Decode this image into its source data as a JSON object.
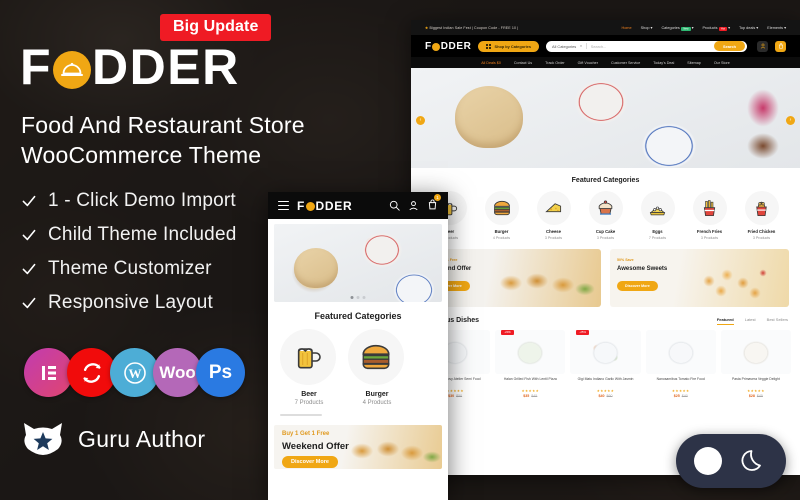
{
  "promo": {
    "badge": "Big Update",
    "brand": "F",
    "brand_rest": "DDER",
    "headline_line1": "Food And Restaurant Store",
    "headline_line2": "WooCommerce Theme",
    "features": [
      "1 - Click Demo Import",
      "Child Theme Included",
      "Theme Customizer",
      "Responsive Layout"
    ],
    "tech_badges": [
      {
        "name": "elementor-icon",
        "label": "E"
      },
      {
        "name": "revolution-slider-icon",
        "label": "↺"
      },
      {
        "name": "wordpress-icon",
        "label": "W"
      },
      {
        "name": "woocommerce-icon",
        "label": "Woo"
      },
      {
        "name": "photoshop-icon",
        "label": "Ps"
      }
    ],
    "author_label": "Guru Author",
    "accent_color": "#f0a714",
    "badge_color": "#ef1b24"
  },
  "desktop": {
    "topbar": {
      "promo_text": "Biggest Indian Sale Fest | Coupon Code - FREE 10 |",
      "nav": [
        {
          "label": "Home",
          "active": true,
          "pill": ""
        },
        {
          "label": "Shop ▾",
          "active": false,
          "pill": ""
        },
        {
          "label": "Categories",
          "active": false,
          "pill": "New"
        },
        {
          "label": "Products",
          "active": false,
          "pill": "Hot"
        },
        {
          "label": "Top deals ▾",
          "active": false,
          "pill": ""
        },
        {
          "label": "Elements ▾",
          "active": false,
          "pill": ""
        }
      ]
    },
    "header": {
      "logo_first": "F",
      "logo_rest": "DDER",
      "shop_by_categories": "Shop by Categories",
      "all_categories": "All Categories",
      "search_placeholder": "Search...",
      "search_button": "Search",
      "account_icon": "user-icon",
      "cart_icon": "cart-icon"
    },
    "subnav": [
      "All Deals $0",
      "Contact Us",
      "Track Order",
      "Gift Voucher",
      "Customer Service",
      "Today's Deal",
      "Sitemap",
      "Our Store"
    ],
    "hero": {
      "prev": "‹",
      "next": "›"
    },
    "featured_title": "Featured Categories",
    "categories": [
      {
        "name": "Beer",
        "count": "7 Products",
        "icon": "beer-mug-icon"
      },
      {
        "name": "Burger",
        "count": "4 Products",
        "icon": "burger-icon"
      },
      {
        "name": "Cheese",
        "count": "3 Products",
        "icon": "cheese-icon"
      },
      {
        "name": "Cup Cake",
        "count": "3 Products",
        "icon": "cupcake-icon"
      },
      {
        "name": "Eggs",
        "count": "7 Products",
        "icon": "eggs-icon"
      },
      {
        "name": "French Fries",
        "count": "3 Products",
        "icon": "french-fries-icon"
      },
      {
        "name": "Fried Chicken",
        "count": "3 Products",
        "icon": "fried-chicken-icon"
      }
    ],
    "banners": [
      {
        "tag": "Buy 1 Get 1 Free",
        "title": "Weekend Offer",
        "button": "Discover More"
      },
      {
        "tag": "50% Save",
        "title": "Awesome Sweets",
        "button": "Discover More"
      }
    ],
    "dishes_title": "Delicious Dishes",
    "dishes_tabs": [
      {
        "label": "Featured",
        "active": true
      },
      {
        "label": "Latest",
        "active": false
      },
      {
        "label": "Best Sellers",
        "active": false
      }
    ],
    "products": [
      {
        "name": "Boiled Anchovy Atelier Semi Food",
        "stars": "★★★★★",
        "price": "$30",
        "old": "$50",
        "sale": ""
      },
      {
        "name": "Halan Grilled Fish With Lentil Pizza",
        "stars": "★★★★★",
        "price": "$35",
        "old": "$45",
        "sale": "-20%"
      },
      {
        "name": "Gigi Matu Indiano Garlic With Jasmin",
        "stars": "★★★★★",
        "price": "$40",
        "old": "$60",
        "sale": "-25%"
      },
      {
        "name": "Nanosamibus Tomato Fire Food",
        "stars": "★★★★★",
        "price": "$25",
        "old": "$40",
        "sale": ""
      },
      {
        "name": "Pasta Primavera Veggie Delight",
        "stars": "★★★★★",
        "price": "$28",
        "old": "$45",
        "sale": ""
      }
    ]
  },
  "mobile": {
    "logo_first": "F",
    "logo_rest": "DDER",
    "menu_icon": "hamburger-menu-icon",
    "search_icon": "search-icon",
    "account_icon": "user-icon",
    "cart_icon": "cart-icon",
    "cart_count": "1",
    "featured_title": "Featured Categories",
    "categories": [
      {
        "name": "Beer",
        "count": "7 Products",
        "icon": "beer-mug-icon"
      },
      {
        "name": "Burger",
        "count": "4 Products",
        "icon": "burger-icon"
      }
    ],
    "banner": {
      "tag": "Buy 1 Get 1 Free",
      "title": "Weekend Offer",
      "button": "Discover More"
    }
  },
  "dark_mode_toggle": {
    "light_icon": "sun-icon",
    "dark_icon": "moon-icon"
  }
}
